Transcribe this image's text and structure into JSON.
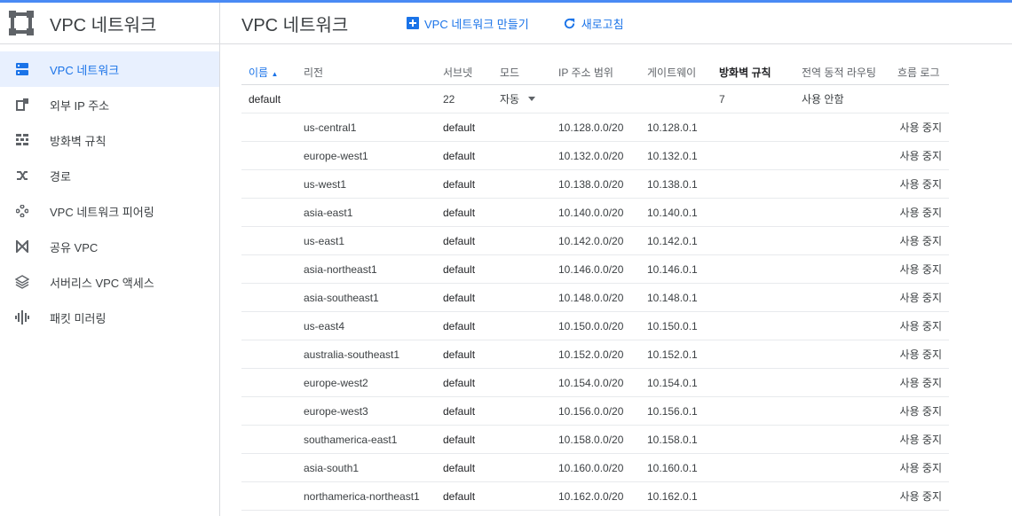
{
  "app": {
    "title": "VPC 네트워크"
  },
  "sidebar": {
    "items": [
      {
        "label": "VPC 네트워크",
        "icon": "vpc-network-icon",
        "active": true
      },
      {
        "label": "외부 IP 주소",
        "icon": "external-ip-icon"
      },
      {
        "label": "방화벽 규칙",
        "icon": "firewall-icon"
      },
      {
        "label": "경로",
        "icon": "routes-icon"
      },
      {
        "label": "VPC 네트워크 피어링",
        "icon": "peering-icon"
      },
      {
        "label": "공유 VPC",
        "icon": "shared-vpc-icon"
      },
      {
        "label": "서버리스 VPC 액세스",
        "icon": "serverless-vpc-icon"
      },
      {
        "label": "패킷 미러링",
        "icon": "packet-mirroring-icon"
      }
    ]
  },
  "header": {
    "title": "VPC 네트워크",
    "create_label": "VPC 네트워크 만들기",
    "refresh_label": "새로고침"
  },
  "table": {
    "columns": [
      "이름",
      "리전",
      "서브넷",
      "모드",
      "IP 주소 범위",
      "게이트웨이",
      "방화벽 규칙",
      "전역 동적 라우팅",
      "흐름 로그"
    ],
    "sort_indicator": "▲",
    "network": {
      "name": "default",
      "subnets": "22",
      "mode": "자동",
      "firewall": "7",
      "routing": "사용 안함"
    },
    "rows": [
      {
        "region": "us-central1",
        "subnet": "default",
        "range": "10.128.0.0/20",
        "gateway": "10.128.0.1",
        "flow": "사용 중지"
      },
      {
        "region": "europe-west1",
        "subnet": "default",
        "range": "10.132.0.0/20",
        "gateway": "10.132.0.1",
        "flow": "사용 중지"
      },
      {
        "region": "us-west1",
        "subnet": "default",
        "range": "10.138.0.0/20",
        "gateway": "10.138.0.1",
        "flow": "사용 중지"
      },
      {
        "region": "asia-east1",
        "subnet": "default",
        "range": "10.140.0.0/20",
        "gateway": "10.140.0.1",
        "flow": "사용 중지"
      },
      {
        "region": "us-east1",
        "subnet": "default",
        "range": "10.142.0.0/20",
        "gateway": "10.142.0.1",
        "flow": "사용 중지"
      },
      {
        "region": "asia-northeast1",
        "subnet": "default",
        "range": "10.146.0.0/20",
        "gateway": "10.146.0.1",
        "flow": "사용 중지"
      },
      {
        "region": "asia-southeast1",
        "subnet": "default",
        "range": "10.148.0.0/20",
        "gateway": "10.148.0.1",
        "flow": "사용 중지"
      },
      {
        "region": "us-east4",
        "subnet": "default",
        "range": "10.150.0.0/20",
        "gateway": "10.150.0.1",
        "flow": "사용 중지"
      },
      {
        "region": "australia-southeast1",
        "subnet": "default",
        "range": "10.152.0.0/20",
        "gateway": "10.152.0.1",
        "flow": "사용 중지"
      },
      {
        "region": "europe-west2",
        "subnet": "default",
        "range": "10.154.0.0/20",
        "gateway": "10.154.0.1",
        "flow": "사용 중지"
      },
      {
        "region": "europe-west3",
        "subnet": "default",
        "range": "10.156.0.0/20",
        "gateway": "10.156.0.1",
        "flow": "사용 중지"
      },
      {
        "region": "southamerica-east1",
        "subnet": "default",
        "range": "10.158.0.0/20",
        "gateway": "10.158.0.1",
        "flow": "사용 중지"
      },
      {
        "region": "asia-south1",
        "subnet": "default",
        "range": "10.160.0.0/20",
        "gateway": "10.160.0.1",
        "flow": "사용 중지"
      },
      {
        "region": "northamerica-northeast1",
        "subnet": "default",
        "range": "10.162.0.0/20",
        "gateway": "10.162.0.1",
        "flow": "사용 중지"
      }
    ]
  },
  "colors": {
    "accent": "#1a73e8",
    "active_bg": "#e8f0fe",
    "topline": "#4a8af4"
  }
}
